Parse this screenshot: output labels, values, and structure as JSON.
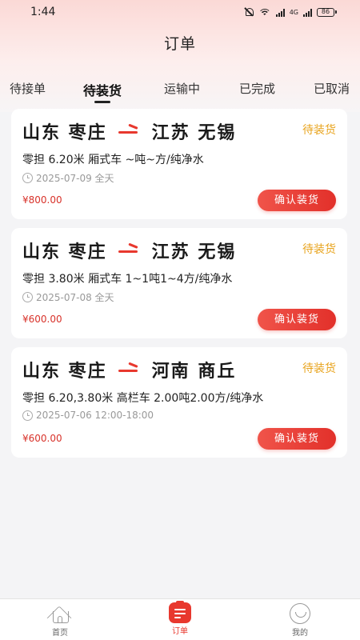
{
  "status_bar": {
    "time": "1:44",
    "network": "4G",
    "battery": "86"
  },
  "header": {
    "title": "订单"
  },
  "tabs": [
    {
      "label": "待接单"
    },
    {
      "label": "待装货"
    },
    {
      "label": "运输中"
    },
    {
      "label": "已完成"
    },
    {
      "label": "已取消"
    }
  ],
  "active_tab": "待装货",
  "orders": [
    {
      "from": "山东 枣庄",
      "to": "江苏 无锡",
      "status": "待装货",
      "detail": "零担 6.20米 厢式车 ~吨~方/纯净水",
      "date": "2025-07-09 全天",
      "price": "¥800.00",
      "action": "确认装货"
    },
    {
      "from": "山东 枣庄",
      "to": "江苏 无锡",
      "status": "待装货",
      "detail": "零担 3.80米 厢式车 1~1吨1~4方/纯净水",
      "date": "2025-07-08 全天",
      "price": "¥600.00",
      "action": "确认装货"
    },
    {
      "from": "山东 枣庄",
      "to": "河南 商丘",
      "status": "待装货",
      "detail": "零担 6.20,3.80米 高栏车 2.00吨2.00方/纯净水",
      "date": "2025-07-06 12:00-18:00",
      "price": "¥600.00",
      "action": "确认装货"
    }
  ],
  "bottom_nav": [
    {
      "label": "首页",
      "icon": "home-icon"
    },
    {
      "label": "订单",
      "icon": "order-icon"
    },
    {
      "label": "我的",
      "icon": "smiley-icon"
    }
  ],
  "colors": {
    "accent": "#e8382e",
    "status": "#e8a31c",
    "price": "#d8322a"
  }
}
